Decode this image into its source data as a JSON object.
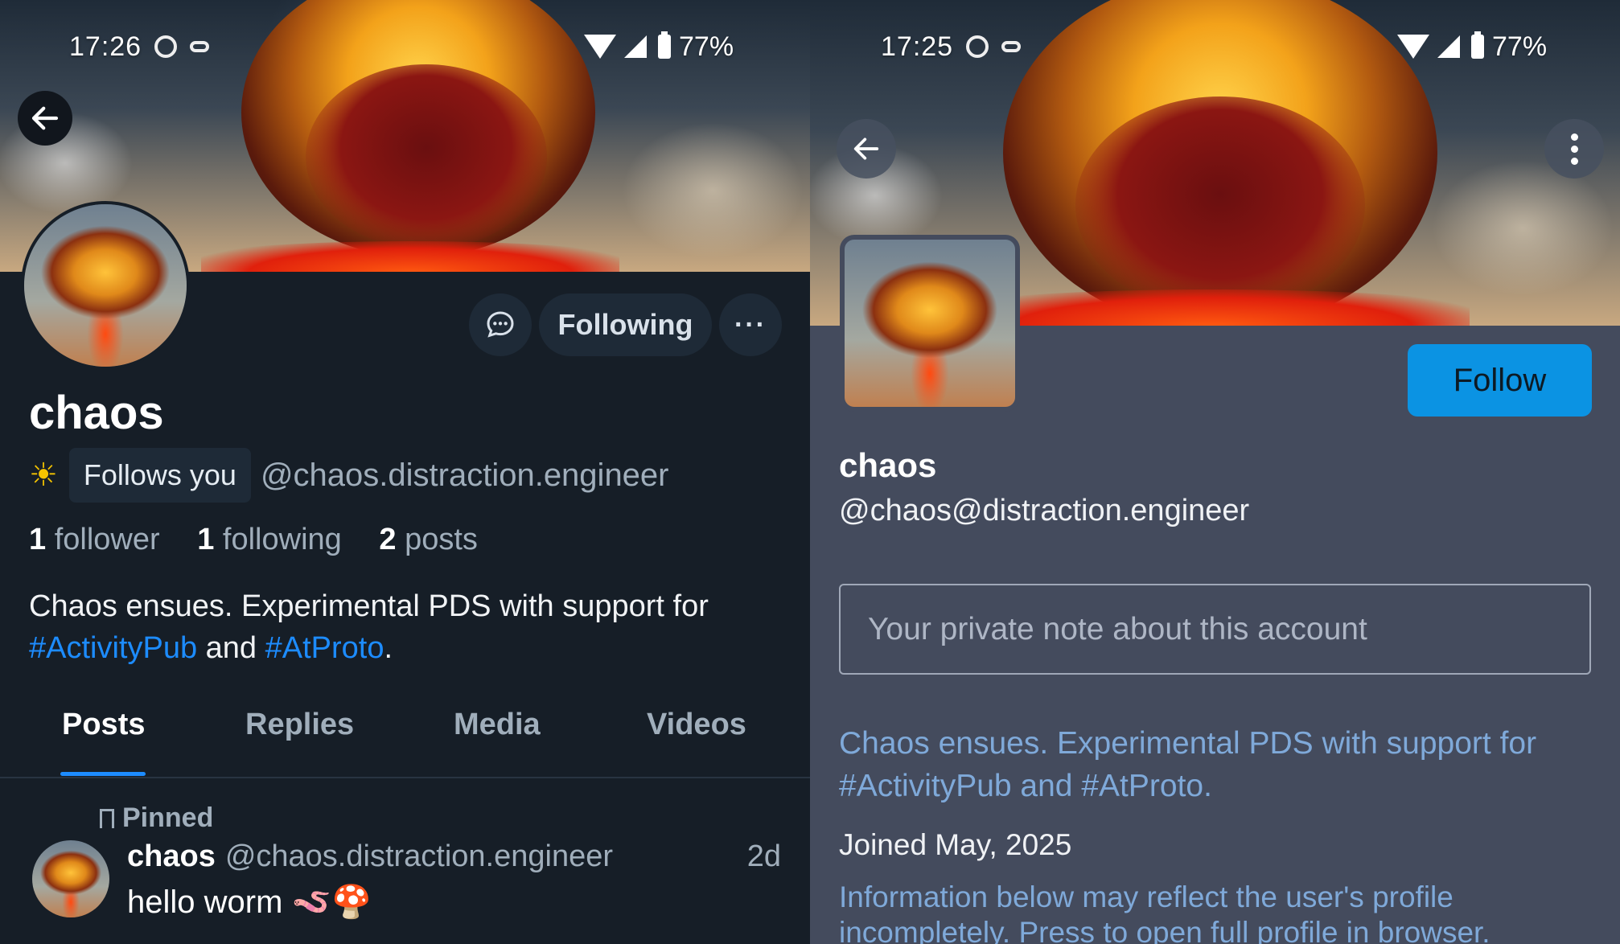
{
  "left": {
    "status": {
      "time": "17:26",
      "battery": "77%"
    },
    "profile": {
      "display_name": "chaos",
      "follows_you": "Follows you",
      "handle": "@chaos.distraction.engineer",
      "stats": {
        "followers_count": "1",
        "followers_label": "follower",
        "following_count": "1",
        "following_label": "following",
        "posts_count": "2",
        "posts_label": "posts"
      },
      "bio": {
        "text1": "Chaos ensues. Experimental PDS with support for",
        "tag1": "#ActivityPub",
        "and": "and",
        "tag2": "#AtProto",
        "end": "."
      }
    },
    "actions": {
      "following_label": "Following",
      "more_label": "···"
    },
    "tabs": [
      "Posts",
      "Replies",
      "Media",
      "Videos"
    ],
    "active_tab": "Posts",
    "post": {
      "pinned_label": "Pinned",
      "author": "chaos",
      "handle": "@chaos.distraction.engineer",
      "time": "2d",
      "text": "hello worm 🪱🍄"
    },
    "colors": {
      "accent": "#1d8cff",
      "background": "#161e27"
    }
  },
  "right": {
    "status": {
      "time": "17:25",
      "battery": "77%"
    },
    "follow_label": "Follow",
    "display_name": "chaos",
    "handle": "@chaos@distraction.engineer",
    "note_placeholder": "Your private note about this account",
    "bio": "Chaos ensues. Experimental PDS with support for #ActivityPub and #AtProto.",
    "joined": "Joined May, 2025",
    "info": "Information below may reflect the user's profile incompletely. Press to open full profile in browser.",
    "colors": {
      "accent": "#0b93e3",
      "background": "#444b5d"
    }
  }
}
